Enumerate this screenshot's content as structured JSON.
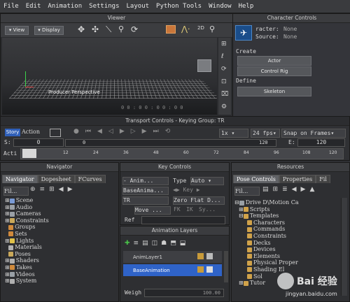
{
  "menu": [
    "File",
    "Edit",
    "Animation",
    "Settings",
    "Layout",
    "Python Tools",
    "Window",
    "Help"
  ],
  "viewer": {
    "title": "Viewer",
    "view_btn": "View",
    "display_btn": "Display",
    "viewport_label": "Producer Perspective",
    "frame_readout": "0 0 : 0 0 : 0 0 : 0 0"
  },
  "character_controls": {
    "title": "Character Controls",
    "character_label": "racter:",
    "character_value": "None",
    "source_label": "Source:",
    "source_value": "None",
    "create_label": "Create",
    "actor_btn": "Actor",
    "control_rig_btn": "Control Rig",
    "define_label": "Define",
    "skeleton_btn": "Skeleton"
  },
  "transport": {
    "title": "Transport Controls  -  Keying Group: TR",
    "story_btn": "Story",
    "action_btn": "Action",
    "speed": "1x",
    "fps": "24 fps",
    "snap": "Snap on Frames",
    "s_label": "S:",
    "s_value": "0",
    "e_label": "E:",
    "e_value": "120",
    "mid_start": "0",
    "mid_end": "120",
    "action_label": "Acti",
    "ruler_ticks": [
      "12",
      "24",
      "36",
      "48",
      "60",
      "72",
      "84",
      "96",
      "108",
      "120"
    ]
  },
  "navigator": {
    "title": "Navigator",
    "tabs": [
      "Navigator",
      "Dopesheet",
      "FCurves"
    ],
    "filter": "Fil...",
    "items": [
      {
        "label": "Scene",
        "color": "#7a9bd6"
      },
      {
        "label": "Audio",
        "color": "#9aa0a6"
      },
      {
        "label": "Cameras",
        "color": "#9aa0a6"
      },
      {
        "label": "Constraints",
        "color": "#c9a85a"
      },
      {
        "label": "Groups",
        "color": "#d08a3c"
      },
      {
        "label": "Sets",
        "color": "#d08a3c"
      },
      {
        "label": "Lights",
        "color": "#e0c24a"
      },
      {
        "label": "Materials",
        "color": "#b0b0b0"
      },
      {
        "label": "Poses",
        "color": "#c9a85a"
      },
      {
        "label": "Shaders",
        "color": "#b0b0b0"
      },
      {
        "label": "Takes",
        "color": "#d08a3c"
      },
      {
        "label": "Videos",
        "color": "#9aa0a6"
      },
      {
        "label": "System",
        "color": "#b0b0b0"
      }
    ]
  },
  "key_controls": {
    "title": "Key Controls",
    "anim_dropdown": "Anim...",
    "type_label": "Type",
    "type_value": "Auto",
    "base_anim": "BaseAnima...",
    "key_label": "Key",
    "tr_value": "TR",
    "zero_flat": "Zero Flat D...",
    "move_label": "Move ...",
    "fk_label": "FK",
    "ik_label": "IK",
    "sy_label": "Sy...",
    "ref_label": "Ref"
  },
  "animation_layers": {
    "title": "Animation Layers",
    "layers": [
      "AnimLayer1",
      "BaseAnimation"
    ],
    "weight_label": "Weigh",
    "weight_value": "100.00"
  },
  "resources": {
    "title": "Resources",
    "tabs": [
      "Pose Controls",
      "Properties",
      "Fil"
    ],
    "filter": "Fil...",
    "tree": [
      {
        "label": "Drive D\\Motion Ca",
        "indent": 0
      },
      {
        "label": "Scripts",
        "indent": 1
      },
      {
        "label": "Templates",
        "indent": 1
      },
      {
        "label": "Characters",
        "indent": 2
      },
      {
        "label": "Commands",
        "indent": 2
      },
      {
        "label": "Constraints",
        "indent": 2
      },
      {
        "label": "Decks",
        "indent": 2
      },
      {
        "label": "Devices",
        "indent": 2
      },
      {
        "label": "Elements",
        "indent": 2
      },
      {
        "label": "Physical Proper",
        "indent": 2
      },
      {
        "label": "Shading El",
        "indent": 2
      },
      {
        "label": "Sol",
        "indent": 2
      },
      {
        "label": "Tutor",
        "indent": 1
      }
    ]
  },
  "watermark": {
    "brand": "Bai 经验",
    "url": "jingyan.baidu.com"
  }
}
